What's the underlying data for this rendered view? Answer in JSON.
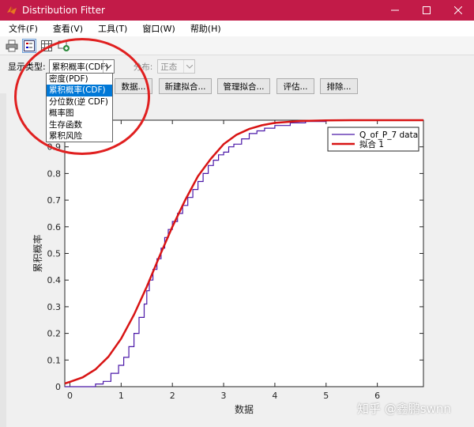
{
  "window": {
    "title": "Distribution Fitter",
    "icon": "matlab-icon",
    "controls": [
      "minimize-icon",
      "maximize-icon",
      "close-icon"
    ]
  },
  "menu": [
    {
      "label": "文件(F)"
    },
    {
      "label": "查看(V)"
    },
    {
      "label": "工具(T)"
    },
    {
      "label": "窗口(W)"
    },
    {
      "label": "帮助(H)"
    }
  ],
  "toolbar": {
    "icons": [
      "print-icon",
      "legend-icon",
      "grid-icon",
      "plot-browser-icon"
    ]
  },
  "display": {
    "label": "显示类型:",
    "selected": "累积概率(CDF)",
    "distribution_label": "分布:",
    "distribution_value": "正态",
    "options": [
      {
        "label": "密度(PDF)"
      },
      {
        "label": "累积概率(CDF)"
      },
      {
        "label": "分位数(逆 CDF)"
      },
      {
        "label": "概率图"
      },
      {
        "label": "生存函数"
      },
      {
        "label": "累积风险"
      }
    ]
  },
  "buttons": {
    "data": "数据...",
    "new_fit": "新建拟合...",
    "manage_fit": "管理拟合...",
    "evaluate": "评估...",
    "exclude": "排除..."
  },
  "colors": {
    "titlebar": "#c21b48",
    "data_series": "#4b18a8",
    "fit_series": "#d81414",
    "annotation": "#e02020"
  },
  "watermark": "知乎 @鑫鹏swnn",
  "chart_data": {
    "type": "line",
    "xlabel": "数据",
    "ylabel": "累积概率",
    "xlim": [
      -0.1,
      6.9
    ],
    "ylim": [
      0,
      1
    ],
    "xticks": [
      0,
      1,
      2,
      3,
      4,
      5,
      6
    ],
    "yticks": [
      0,
      0.1,
      0.2,
      0.3,
      0.4,
      0.5,
      0.6,
      0.7,
      0.8,
      0.9
    ],
    "legend_position": "top-right",
    "series": [
      {
        "name": "Q_of_P_7 data",
        "x": [
          -0.1,
          0.3,
          0.5,
          0.65,
          0.8,
          0.95,
          1.05,
          1.15,
          1.25,
          1.35,
          1.45,
          1.5,
          1.55,
          1.62,
          1.7,
          1.78,
          1.85,
          1.92,
          2.0,
          2.1,
          2.2,
          2.3,
          2.4,
          2.5,
          2.6,
          2.7,
          2.8,
          2.9,
          3.0,
          3.1,
          3.2,
          3.35,
          3.5,
          3.65,
          3.8,
          4.0,
          4.3,
          4.6,
          5.0,
          5.5,
          6.0,
          6.9
        ],
        "y": [
          0,
          0.0,
          0.01,
          0.02,
          0.05,
          0.08,
          0.11,
          0.15,
          0.2,
          0.26,
          0.31,
          0.36,
          0.4,
          0.44,
          0.48,
          0.52,
          0.56,
          0.59,
          0.62,
          0.65,
          0.68,
          0.71,
          0.74,
          0.77,
          0.8,
          0.83,
          0.85,
          0.87,
          0.88,
          0.9,
          0.91,
          0.93,
          0.95,
          0.96,
          0.97,
          0.98,
          0.99,
          0.995,
          1.0,
          1.0,
          1.0,
          1.0
        ]
      },
      {
        "name": "拟合 1",
        "x": [
          -0.1,
          0.0,
          0.25,
          0.5,
          0.75,
          1.0,
          1.25,
          1.5,
          1.75,
          2.0,
          2.25,
          2.5,
          2.75,
          3.0,
          3.25,
          3.5,
          3.75,
          4.0,
          4.5,
          5.0,
          5.5,
          6.0,
          6.9
        ],
        "y": [
          0.012,
          0.018,
          0.035,
          0.065,
          0.112,
          0.18,
          0.27,
          0.375,
          0.49,
          0.6,
          0.7,
          0.79,
          0.855,
          0.91,
          0.945,
          0.967,
          0.981,
          0.99,
          0.997,
          0.999,
          1.0,
          1.0,
          1.0
        ]
      }
    ]
  }
}
